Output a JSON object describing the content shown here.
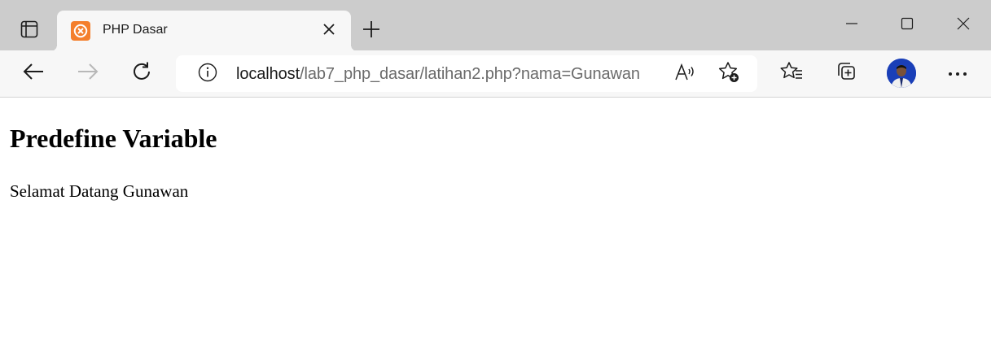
{
  "browser": {
    "tab": {
      "title": "PHP Dasar",
      "favicon": "xampp-logo-icon"
    },
    "address_bar": {
      "host": "localhost",
      "path": "/lab7_php_dasar/latihan2.php?nama=Gunawan"
    },
    "icons": {
      "tab_actions": "tab-actions-icon",
      "close_tab": "close-icon",
      "new_tab": "plus-icon",
      "minimize": "minimize-icon",
      "maximize": "maximize-icon",
      "close_window": "close-icon",
      "back": "back-arrow-icon",
      "forward": "forward-arrow-icon",
      "refresh": "refresh-icon",
      "site_info": "info-icon",
      "read_aloud": "read-aloud-icon",
      "add_favorite": "add-favorite-icon",
      "favorites": "favorites-icon",
      "collections": "collections-icon",
      "profile": "avatar",
      "more": "more-icon"
    },
    "colors": {
      "tab_strip": "#cccccc",
      "toolbar": "#f7f7f7",
      "favicon": "#f47f2c",
      "avatar": "#1a3fb8"
    }
  },
  "page": {
    "heading": "Predefine Variable",
    "greeting": "Selamat Datang Gunawan"
  }
}
